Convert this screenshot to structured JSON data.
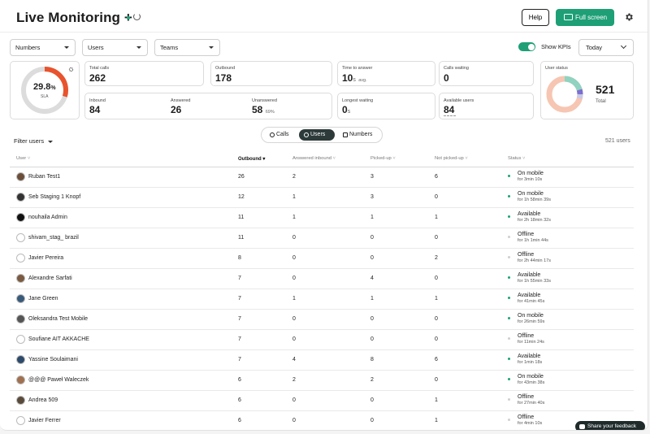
{
  "header": {
    "title": "Live Monitoring +",
    "help_label": "Help",
    "fullscreen_label": "Full screen"
  },
  "filters": {
    "numbers": "Numbers",
    "users": "Users",
    "teams": "Teams",
    "show_kpis": "Show KPIs",
    "period": "Today"
  },
  "kpis": {
    "sla_value": "29.8",
    "sla_unit": "%",
    "sla_label": "SLA",
    "sla_percent": 29.8,
    "total_calls_label": "Total calls",
    "total_calls": "262",
    "outbound_label": "Outbound",
    "outbound": "178",
    "time_to_answer_label": "Time to answer",
    "time_to_answer": "10",
    "time_to_answer_unit": "s",
    "time_to_answer_sub": "avg.",
    "calls_waiting_label": "Calls waiting",
    "calls_waiting": "0",
    "inbound_label": "Inbound",
    "inbound": "84",
    "answered_label": "Answered",
    "answered": "26",
    "unanswered_label": "Unanswered",
    "unanswered": "58",
    "unanswered_pct": "69%",
    "longest_waiting_label": "Longest waiting",
    "longest_waiting": "0",
    "longest_waiting_unit": "s",
    "available_users_label": "Available users",
    "available_users": "84",
    "user_status_label": "User status",
    "user_status_total": "521",
    "user_status_total_label": "Total"
  },
  "tabs": {
    "calls": "Calls",
    "users": "Users",
    "numbers": "Numbers"
  },
  "list": {
    "filter_label": "Filter users",
    "count_label": "521 users"
  },
  "columns": [
    "User",
    "Outbound",
    "Answered inbound",
    "Picked-up",
    "Not picked-up",
    "Status"
  ],
  "rows": [
    {
      "name": "Ruban Test1",
      "outbound": "26",
      "answered": "2",
      "picked": "3",
      "not_picked": "6",
      "status": "On mobile",
      "duration": "for 3min 10s",
      "status_color": "#1aa37a"
    },
    {
      "name": "Seb Staging 1 Knopf",
      "outbound": "12",
      "answered": "1",
      "picked": "3",
      "not_picked": "0",
      "status": "On mobile",
      "duration": "for 1h 58min 39s",
      "status_color": "#1aa37a"
    },
    {
      "name": "nouhaila Admin",
      "outbound": "11",
      "answered": "1",
      "picked": "1",
      "not_picked": "1",
      "status": "Available",
      "duration": "for 2h 18min 32s",
      "status_color": "#1aa37a"
    },
    {
      "name": "shivam_stag_ brazil",
      "outbound": "11",
      "answered": "0",
      "picked": "0",
      "not_picked": "0",
      "status": "Offline",
      "duration": "for 1h 1min 44s",
      "status_color": "#cfcfcf"
    },
    {
      "name": "Javier Pereira",
      "outbound": "8",
      "answered": "0",
      "picked": "0",
      "not_picked": "2",
      "status": "Offline",
      "duration": "for 2h 44min 17s",
      "status_color": "#cfcfcf"
    },
    {
      "name": "Alexandre Sarfati",
      "outbound": "7",
      "answered": "0",
      "picked": "4",
      "not_picked": "0",
      "status": "Available",
      "duration": "for 1h 55min 33s",
      "status_color": "#1aa37a"
    },
    {
      "name": "Jane Green",
      "outbound": "7",
      "answered": "1",
      "picked": "1",
      "not_picked": "1",
      "status": "Available",
      "duration": "for 41min 45s",
      "status_color": "#1aa37a"
    },
    {
      "name": "Oleksandra Test Mobile",
      "outbound": "7",
      "answered": "0",
      "picked": "0",
      "not_picked": "0",
      "status": "On mobile",
      "duration": "for 26min 59s",
      "status_color": "#1aa37a"
    },
    {
      "name": "Soufiane AIT AKKACHE",
      "outbound": "7",
      "answered": "0",
      "picked": "0",
      "not_picked": "0",
      "status": "Offline",
      "duration": "for 11min 24s",
      "status_color": "#cfcfcf"
    },
    {
      "name": "Yassine Soulaimani",
      "outbound": "7",
      "answered": "4",
      "picked": "8",
      "not_picked": "6",
      "status": "Available",
      "duration": "for 1min 18s",
      "status_color": "#1aa37a"
    },
    {
      "name": "@@@ Paweł Waleczek",
      "outbound": "6",
      "answered": "2",
      "picked": "2",
      "not_picked": "0",
      "status": "On mobile",
      "duration": "for 43min 38s",
      "status_color": "#1aa37a"
    },
    {
      "name": "Andrea 509",
      "outbound": "6",
      "answered": "0",
      "picked": "0",
      "not_picked": "1",
      "status": "Offline",
      "duration": "for 27min 40s",
      "status_color": "#cfcfcf"
    },
    {
      "name": "Javier Ferrer",
      "outbound": "6",
      "answered": "0",
      "picked": "0",
      "not_picked": "1",
      "status": "Offline",
      "duration": "for 4min 10s",
      "status_color": "#cfcfcf"
    }
  ],
  "feedback_label": "Share your feedback",
  "colors": {
    "accent": "#1e9f76",
    "sla": "#e8532d",
    "dark": "#2d3a3a"
  }
}
